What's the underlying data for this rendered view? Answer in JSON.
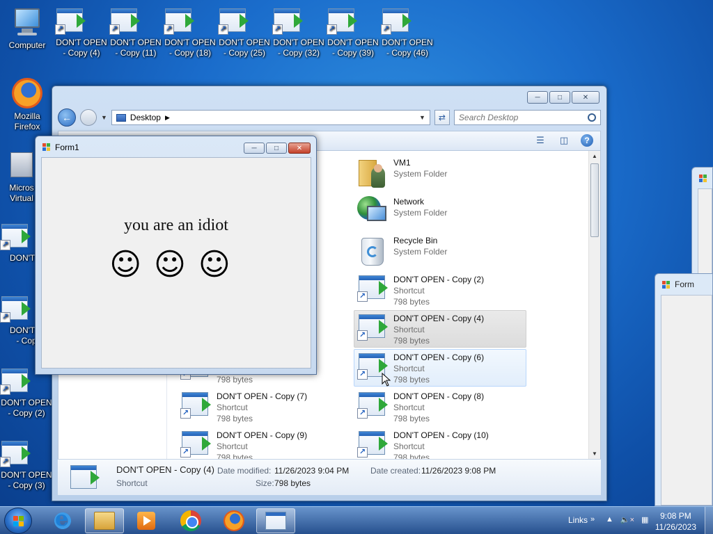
{
  "desktop": {
    "top_icons": [
      {
        "label": "Computer",
        "icon": "computer-icon"
      },
      {
        "label": "DON'T OPEN - Copy (4)",
        "line1": "DON'T OPEN",
        "line2": "- Copy (4)"
      },
      {
        "label": "DON'T OPEN - Copy (11)",
        "line1": "DON'T OPEN",
        "line2": "- Copy (11)"
      },
      {
        "label": "DON'T OPEN - Copy (18)",
        "line1": "DON'T OPEN",
        "line2": "- Copy (18)"
      },
      {
        "label": "DON'T OPEN - Copy (25)",
        "line1": "DON'T OPEN",
        "line2": "- Copy (25)"
      },
      {
        "label": "DON'T OPEN - Copy (32)",
        "line1": "DON'T OPEN",
        "line2": "- Copy (32)"
      },
      {
        "label": "DON'T OPEN - Copy (39)",
        "line1": "DON'T OPEN",
        "line2": "- Copy (39)"
      },
      {
        "label": "DON'T OPEN - Copy (46)",
        "line1": "DON'T OPEN",
        "line2": "- Copy (46)"
      }
    ],
    "left_icons": [
      {
        "line1": "Mozilla",
        "line2": "Firefox",
        "icon": "firefox-icon"
      },
      {
        "line1": "Micros",
        "line2": "Virtual",
        "icon": "virtual-pc-icon"
      },
      {
        "line1": "DON'T C",
        "line2": ""
      },
      {
        "line1": "DON'T C",
        "line2": "- Cop"
      },
      {
        "line1": "DON'T OPEN",
        "line2": "- Copy (2)"
      },
      {
        "line1": "DON'T OPEN",
        "line2": "- Copy (3)"
      }
    ]
  },
  "explorer": {
    "address": "Desktop",
    "search_placeholder": "Search Desktop",
    "items": [
      {
        "name": "VM1",
        "type": "System Folder",
        "size": "",
        "icon": "user-folder-icon"
      },
      {
        "name": "Network",
        "type": "System Folder",
        "size": "",
        "icon": "network-icon"
      },
      {
        "name": "Recycle Bin",
        "type": "System Folder",
        "size": "",
        "icon": "recycle-bin-icon"
      },
      {
        "name": "DON'T OPEN - Copy (2)",
        "type": "Shortcut",
        "size": "798 bytes"
      },
      {
        "name": "DON'T OPEN - Copy (4)",
        "type": "Shortcut",
        "size": "798 bytes",
        "state": "selected"
      },
      {
        "name": "DON'T OPEN - Copy (6)",
        "type": "Shortcut",
        "size": "798 bytes",
        "state": "hover"
      },
      {
        "name": "DON'T OPEN - Copy (7)",
        "type": "Shortcut",
        "size": "798 bytes"
      },
      {
        "name": "DON'T OPEN - Copy (8)",
        "type": "Shortcut",
        "size": "798 bytes"
      },
      {
        "name": "DON'T OPEN - Copy (9)",
        "type": "Shortcut",
        "size": "798 bytes"
      },
      {
        "name": "DON'T OPEN - Copy (10)",
        "type": "Shortcut",
        "size": "798 bytes"
      }
    ],
    "partial_item_size": "798 bytes",
    "details": {
      "name": "DON'T OPEN - Copy (4)",
      "type": "Shortcut",
      "modified_label": "Date modified:",
      "modified": "11/26/2023 9:04 PM",
      "created_label": "Date created:",
      "created": "11/26/2023 9:08 PM",
      "size_label": "Size:",
      "size": "798 bytes"
    }
  },
  "form1": {
    "title": "Form1",
    "message": "you are an idiot",
    "faces": "☺☺☺"
  },
  "background_forms": {
    "title": "Form"
  },
  "taskbar": {
    "links_label": "Links",
    "time": "9:08 PM",
    "date": "11/26/2023"
  },
  "colors": {
    "desktop_blue": "#1a6ccb",
    "selection": "#dcdcdc",
    "hover": "#e2eefb",
    "close_red": "#c4412a"
  }
}
